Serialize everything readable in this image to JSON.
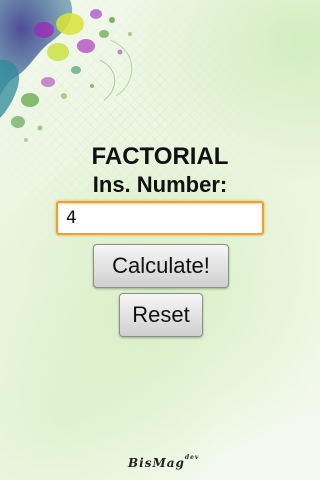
{
  "app": {
    "title": "FACTORIAL",
    "prompt": "Ins. Number:"
  },
  "number_input": {
    "value": "4",
    "placeholder": ""
  },
  "buttons": {
    "calculate_label": "Calculate!",
    "reset_label": "Reset"
  },
  "brand": {
    "name": "BisMag",
    "suffix": "dev"
  },
  "colors": {
    "input_focus_border": "#f0a030",
    "text": "#111111"
  }
}
